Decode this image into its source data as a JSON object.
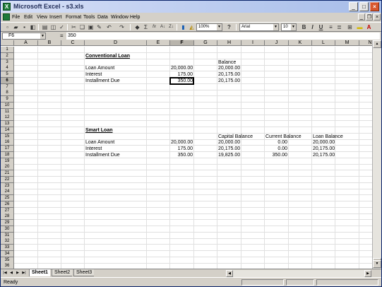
{
  "window": {
    "title": "Microsoft Excel - s3.xls",
    "app_icon": "excel-icon",
    "buttons": {
      "minimize": "_",
      "maximize": "□",
      "close": "×"
    }
  },
  "menu": {
    "items": [
      "File",
      "Edit",
      "View",
      "Insert",
      "Format",
      "Tools",
      "Data",
      "Window",
      "Help"
    ],
    "doc_buttons": {
      "minimize": "_",
      "restore": "❐",
      "close": "×"
    }
  },
  "toolbar": {
    "zoom": "100%",
    "font": "Arial",
    "font_size": "10",
    "bold": "B",
    "italic": "I",
    "underline": "U",
    "help": "?",
    "autosum": "Σ",
    "function": "fx",
    "icons": [
      "new-icon",
      "open-icon",
      "save-icon",
      "permission-icon",
      "print-icon",
      "print-preview-icon",
      "spelling-icon",
      "cut-icon",
      "copy-icon",
      "paste-icon",
      "format-painter-icon",
      "undo-icon",
      "redo-icon",
      "hyperlink-icon",
      "autosum-icon",
      "function-icon",
      "sort-ascending-icon",
      "sort-descending-icon",
      "chart-wizard-icon",
      "drawing-icon",
      "align-left-icon",
      "center-icon",
      "borders-icon",
      "fill-color-icon",
      "font-color-icon"
    ]
  },
  "formula_bar": {
    "name_box": "F6",
    "equals": "=",
    "content": "350"
  },
  "grid": {
    "columns": [
      "A",
      "B",
      "C",
      "D",
      "E",
      "F",
      "G",
      "H",
      "I",
      "J",
      "K",
      "L",
      "M",
      "N"
    ],
    "rows": [
      "1",
      "2",
      "3",
      "4",
      "5",
      "6",
      "7",
      "8",
      "9",
      "10",
      "11",
      "12",
      "13",
      "14",
      "15",
      "16",
      "17",
      "18",
      "19",
      "20",
      "21",
      "22",
      "23",
      "24",
      "25",
      "26",
      "27",
      "28",
      "29",
      "30",
      "31",
      "32",
      "33",
      "34",
      "35",
      "36"
    ],
    "active_cell": "F6",
    "cells": {
      "D2": "Conventional Loan",
      "H3": "Balance",
      "D4": "Loan Amount",
      "F4": "20,000.00",
      "H4": "20,000.00",
      "D5": "Interest",
      "F5": "175.00",
      "H5": "20,175.00",
      "D6": "Installment Due",
      "F6": "350.00",
      "H6": "20,175.00",
      "D14": "Smart Loan",
      "H15": "Capital Balance",
      "J15": "Current Balance",
      "L15": "Loan Balance",
      "D16": "Loan Amount",
      "F16": "20,000.00",
      "H16": "20,000.00",
      "J16": "0.00",
      "L16": "20,000.00",
      "D17": "Interest",
      "F17": "175.00",
      "H17": "20,175.00",
      "J17": "0.00",
      "L17": "20,175.00",
      "D18": "Installment Due",
      "F18": "350.00",
      "H18": "19,825.00",
      "J18": "350.00",
      "L18": "20,175.00"
    }
  },
  "sheets": {
    "tabs": [
      "Sheet1",
      "Sheet2",
      "Sheet3"
    ],
    "active": "Sheet1"
  },
  "status": {
    "text": "Ready"
  }
}
